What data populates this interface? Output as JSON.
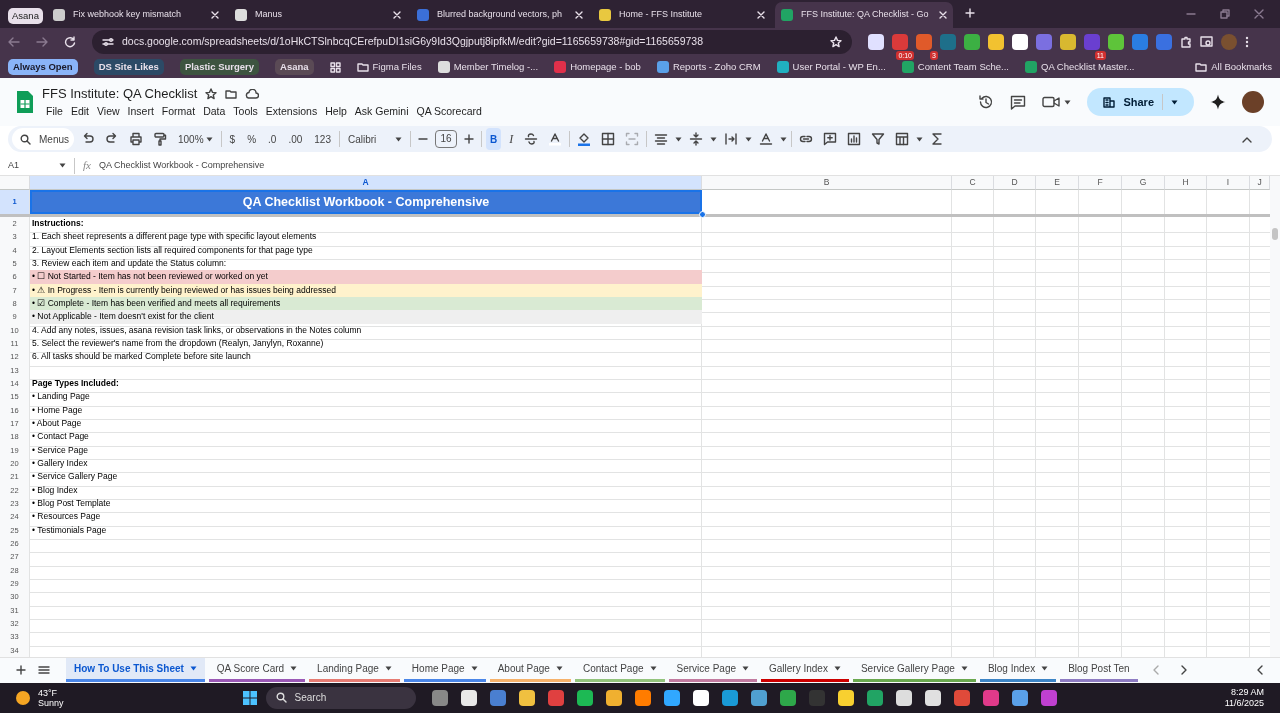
{
  "browser": {
    "tab_group": "Asana",
    "tabs": [
      {
        "label": "Fix webhook key mismatch",
        "selected": false,
        "color": "#cccccc"
      },
      {
        "label": "Manus",
        "selected": false,
        "color": "#dddddd"
      },
      {
        "label": "Blurred background vectors, ph",
        "selected": false,
        "color": "#3b6fd8"
      },
      {
        "label": "Home - FFS Institute",
        "selected": false,
        "color": "#e8c840"
      },
      {
        "label": "FFS Institute: QA Checklist - Go",
        "selected": true,
        "color": "#21a464"
      }
    ],
    "url": "docs.google.com/spreadsheets/d/1oHkCTSlnbcqCErefpuDI1siG6y9Id3Qgjputj8ipfkM/edit?gid=1165659738#gid=1165659738",
    "extensions": [
      {
        "color": "#e0e0ff"
      },
      {
        "color": "#d93a3a",
        "badge": "0:10"
      },
      {
        "color": "#e05a2a",
        "badge": "3"
      },
      {
        "color": "#1e6f8a"
      },
      {
        "color": "#3cb043"
      },
      {
        "color": "#f2c230"
      },
      {
        "color": "#ffffff"
      },
      {
        "color": "#7b6fe0"
      },
      {
        "color": "#d8b830"
      },
      {
        "color": "#6a3fd0",
        "badge": "11"
      },
      {
        "color": "#5ec43a"
      },
      {
        "color": "#2a7de1"
      },
      {
        "color": "#3a70e0"
      }
    ],
    "bookmarks": [
      {
        "label": "Always Open",
        "kind": "group",
        "color": "#8ab4f8"
      },
      {
        "label": "DS Site Likes",
        "kind": "group",
        "color": "#2c4a66"
      },
      {
        "label": "Plastic Surgery",
        "kind": "group",
        "color": "#3d5440"
      },
      {
        "label": "Asana",
        "kind": "group",
        "color": "#5a4a55"
      },
      {
        "label": "Figma Files",
        "kind": "folder"
      },
      {
        "label": "Member Timelog -...",
        "kind": "link",
        "color": "#dddddd"
      },
      {
        "label": "Homepage - bob",
        "kind": "link",
        "color": "#e0304a"
      },
      {
        "label": "Reports - Zoho CRM",
        "kind": "link",
        "color": "#5aa0e8"
      },
      {
        "label": "User Portal - WP En...",
        "kind": "link",
        "color": "#20b0c0"
      },
      {
        "label": "Content Team Sche...",
        "kind": "link",
        "color": "#21a464"
      },
      {
        "label": "QA Checklist Master...",
        "kind": "link",
        "color": "#21a464"
      }
    ],
    "all_bookmarks": "All Bookmarks"
  },
  "doc": {
    "title": "FFS Institute: QA Checklist",
    "menus": [
      "File",
      "Edit",
      "View",
      "Insert",
      "Format",
      "Data",
      "Tools",
      "Extensions",
      "Help",
      "Ask Gemini",
      "QA Scorecard"
    ],
    "share": "Share"
  },
  "toolbar": {
    "search_placeholder": "Menus",
    "zoom": "100%",
    "currency": "$",
    "percent": "%",
    "decrease_decimals": ".0",
    "increase_decimals": ".00",
    "number_format": "123",
    "font": "Calibri",
    "font_size": "16",
    "bold_label": "B",
    "bold": true,
    "italic_label": "I",
    "italic": false
  },
  "formula_bar": {
    "cell": "A1",
    "function_label": "fx",
    "value": "QA Checklist Workbook - Comprehensive"
  },
  "columns": [
    {
      "label": "A",
      "selected": true
    },
    {
      "label": "B",
      "selected": false
    },
    {
      "label": "C",
      "selected": false
    },
    {
      "label": "D",
      "selected": false
    },
    {
      "label": "E",
      "selected": false
    },
    {
      "label": "F",
      "selected": false
    },
    {
      "label": "G",
      "selected": false
    },
    {
      "label": "H",
      "selected": false
    },
    {
      "label": "I",
      "selected": false
    },
    {
      "label": "J",
      "selected": false
    }
  ],
  "rows": [
    {
      "number": "1",
      "kind": "title",
      "text": "QA Checklist Workbook - Comprehensive",
      "color": "#3c78d8",
      "selected": true
    },
    {
      "number": "2",
      "kind": "heading",
      "text": "Instructions:"
    },
    {
      "number": "3",
      "kind": "text",
      "text": "1. Each sheet represents a different page type with specific layout elements"
    },
    {
      "number": "4",
      "kind": "text",
      "text": "2. Layout Elements section lists all required components for that page type"
    },
    {
      "number": "5",
      "kind": "text",
      "text": "3. Review each item and update the Status column:"
    },
    {
      "number": "6",
      "kind": "status",
      "text": "• ☐ Not Started - Item has not been reviewed or worked on yet",
      "color": "#f4cccc"
    },
    {
      "number": "7",
      "kind": "status",
      "text": "• ⚠ In Progress - Item is currently being reviewed or has issues being addressed",
      "color": "#fff2cc"
    },
    {
      "number": "8",
      "kind": "status",
      "text": "• ☑ Complete - Item has been verified and meets all requirements",
      "color": "#d9ead3"
    },
    {
      "number": "9",
      "kind": "status",
      "text": "• Not Applicable - Item doesn't exist for the client",
      "color": "#efefef"
    },
    {
      "number": "10",
      "kind": "text",
      "text": "4. Add any notes, issues, asana revision task links, or observations in the Notes column"
    },
    {
      "number": "11",
      "kind": "text",
      "text": "5. Select the reviewer's name from the dropdown (Realyn, Janylyn, Roxanne)"
    },
    {
      "number": "12",
      "kind": "text",
      "text": "6. All tasks should be marked Complete before site launch"
    },
    {
      "number": "13",
      "kind": "empty"
    },
    {
      "number": "14",
      "kind": "heading",
      "text": "Page Types Included:"
    },
    {
      "number": "15",
      "kind": "text",
      "text": "• Landing Page"
    },
    {
      "number": "16",
      "kind": "text",
      "text": "• Home Page"
    },
    {
      "number": "17",
      "kind": "text",
      "text": "• About Page"
    },
    {
      "number": "18",
      "kind": "text",
      "text": "• Contact Page"
    },
    {
      "number": "19",
      "kind": "text",
      "text": "• Service Page"
    },
    {
      "number": "20",
      "kind": "text",
      "text": "• Gallery Index"
    },
    {
      "number": "21",
      "kind": "text",
      "text": "• Service Gallery Page"
    },
    {
      "number": "22",
      "kind": "text",
      "text": "• Blog Index"
    },
    {
      "number": "23",
      "kind": "text",
      "text": "• Blog Post Template"
    },
    {
      "number": "24",
      "kind": "text",
      "text": "• Resources Page"
    },
    {
      "number": "25",
      "kind": "text",
      "text": "• Testimonials Page"
    },
    {
      "number": "26",
      "kind": "empty"
    },
    {
      "number": "27",
      "kind": "empty"
    },
    {
      "number": "28",
      "kind": "empty"
    },
    {
      "number": "29",
      "kind": "empty"
    },
    {
      "number": "30",
      "kind": "empty"
    },
    {
      "number": "31",
      "kind": "empty"
    },
    {
      "number": "32",
      "kind": "empty"
    },
    {
      "number": "33",
      "kind": "empty"
    },
    {
      "number": "34",
      "kind": "empty"
    }
  ],
  "sheet_tabs": [
    {
      "label": "How To Use This Sheet",
      "selected": true,
      "color": "#4a86e8"
    },
    {
      "label": "QA Score Card",
      "selected": false,
      "color": "#9b59b6"
    },
    {
      "label": "Landing Page",
      "selected": false,
      "color": "#e67c73"
    },
    {
      "label": "Home Page",
      "selected": false,
      "color": "#4a86e8"
    },
    {
      "label": "About Page",
      "selected": false,
      "color": "#f6b26b"
    },
    {
      "label": "Contact Page",
      "selected": false,
      "color": "#93c47d"
    },
    {
      "label": "Service Page",
      "selected": false,
      "color": "#c27ba0"
    },
    {
      "label": "Gallery Index",
      "selected": false,
      "color": "#cc0000"
    },
    {
      "label": "Service Gallery Page",
      "selected": false,
      "color": "#6aa84f"
    },
    {
      "label": "Blog Index",
      "selected": false,
      "color": "#3d85c6"
    },
    {
      "label": "Blog Post Ten",
      "selected": false,
      "color": "#8e7cc3"
    }
  ],
  "taskbar": {
    "temperature": "43°F",
    "weather": "Sunny",
    "search_placeholder": "Search",
    "apps": [
      {
        "color": "#888888"
      },
      {
        "color": "#e8e8e8"
      },
      {
        "color": "#4a7fd0"
      },
      {
        "color": "#f0c040"
      },
      {
        "color": "#e04040"
      },
      {
        "color": "#1db954"
      },
      {
        "color": "#f0b030"
      },
      {
        "color": "#ff7c00"
      },
      {
        "color": "#31a8ff"
      },
      {
        "color": "#ffffff"
      },
      {
        "color": "#1a9ad6"
      },
      {
        "color": "#50a0d0"
      },
      {
        "color": "#2ea84a"
      },
      {
        "color": "#333333"
      },
      {
        "color": "#f8d030"
      },
      {
        "color": "#21a464"
      },
      {
        "color": "#dddddd"
      },
      {
        "color": "#e0e0e0"
      },
      {
        "color": "#e04a3a"
      },
      {
        "color": "#e03a8a"
      },
      {
        "color": "#5aa0e8"
      },
      {
        "color": "#c040d0"
      }
    ],
    "time": "8:29 AM",
    "date": "11/6/2025"
  }
}
